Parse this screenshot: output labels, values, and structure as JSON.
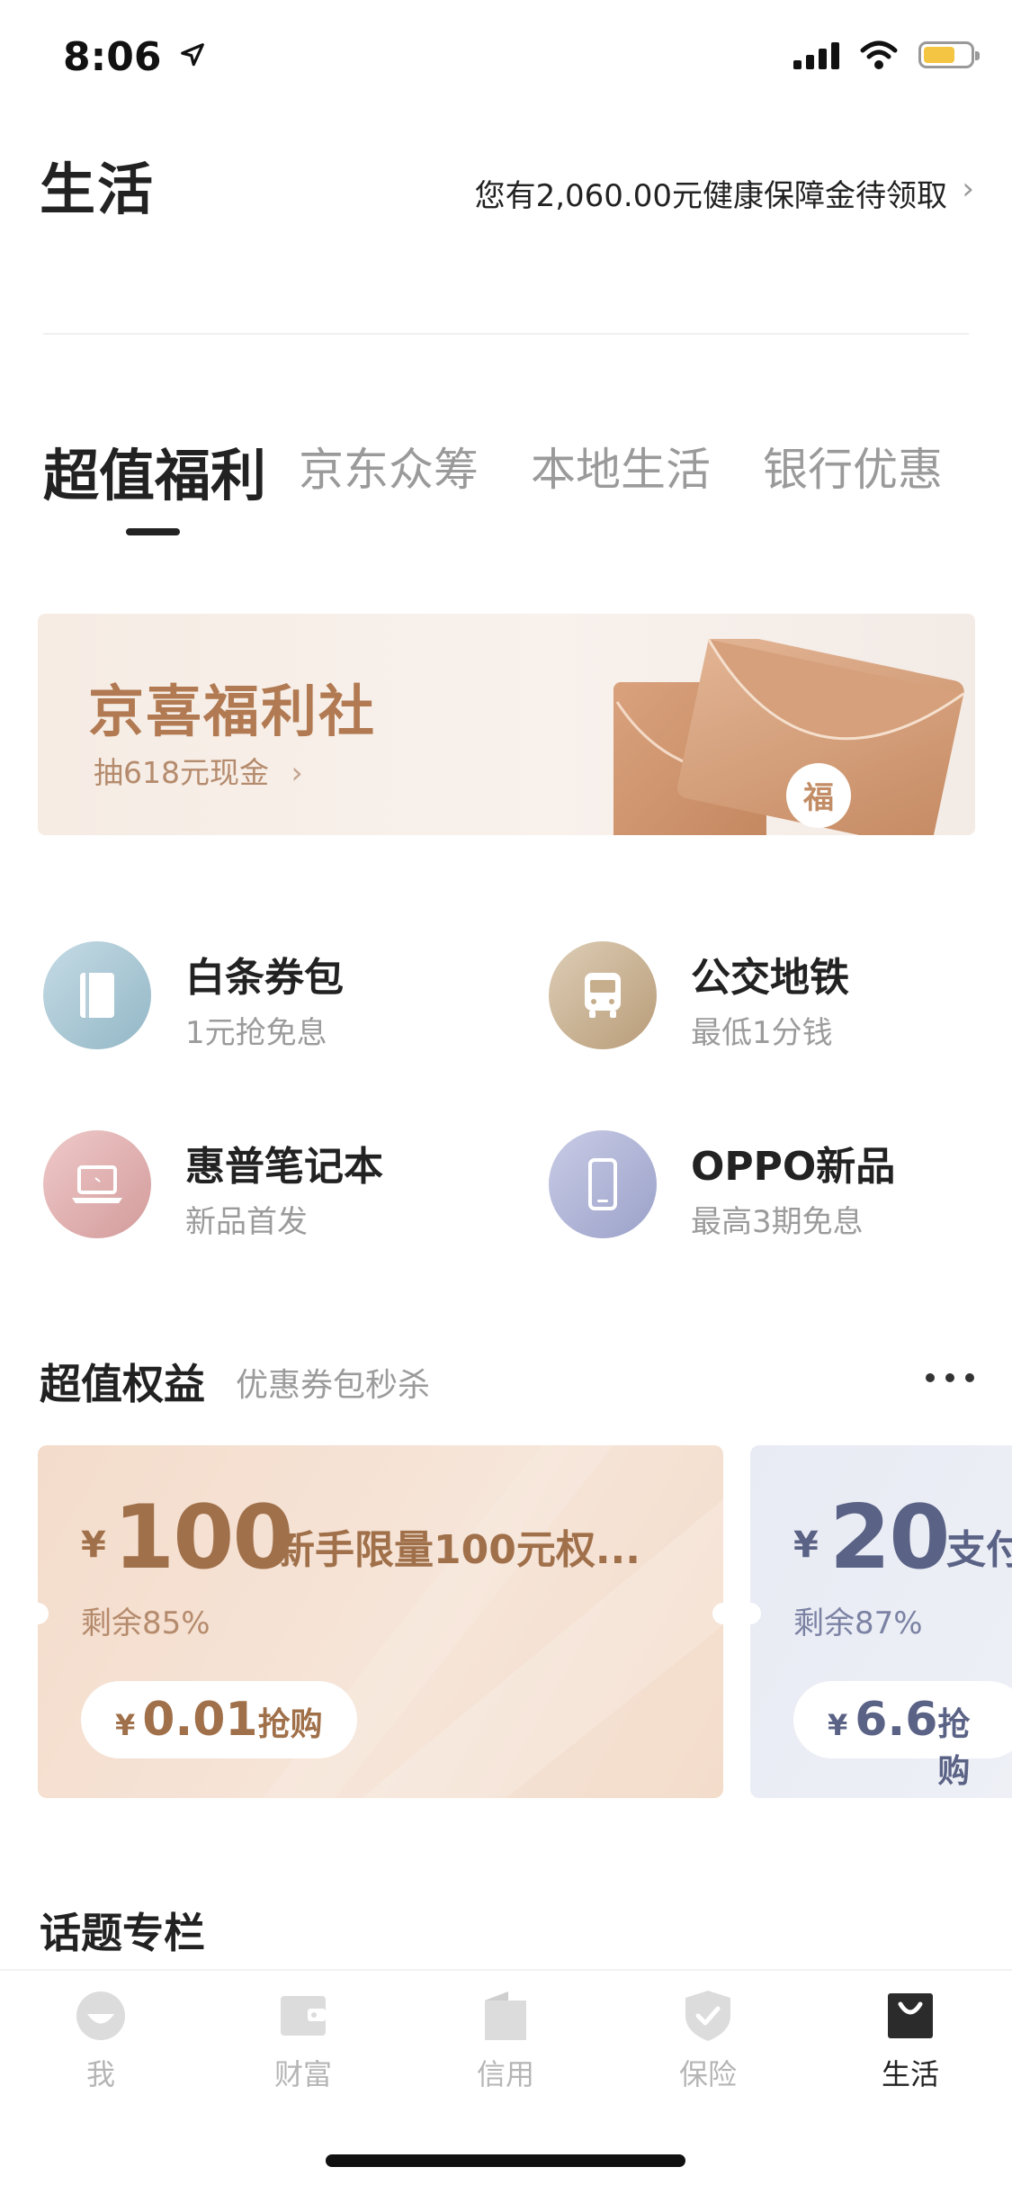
{
  "status_bar": {
    "time": "8:06",
    "icons": [
      "location-arrow-icon",
      "signal-icon",
      "wifi-icon",
      "battery-icon"
    ],
    "battery_color": "#f4c542"
  },
  "header": {
    "title": "生活",
    "promo_text": "您有2,060.00元健康保障金待领取",
    "promo_chevron": "›"
  },
  "tabs": [
    {
      "label": "超值福利",
      "active": true
    },
    {
      "label": "京东众筹",
      "active": false
    },
    {
      "label": "本地生活",
      "active": false
    },
    {
      "label": "银行优惠",
      "active": false
    }
  ],
  "banner": {
    "title": "京喜福利社",
    "subtitle": "抽618元现金",
    "chevron": "›",
    "seal_char": "福",
    "accent": "#b17a52"
  },
  "quick_grid": [
    {
      "title": "白条券包",
      "sub": "1元抢免息",
      "icon": "coupon-book-icon",
      "color": "#a9c7d6"
    },
    {
      "title": "公交地铁",
      "sub": "最低1分钱",
      "icon": "bus-icon",
      "color": "#cdb79a"
    },
    {
      "title": "惠普笔记本",
      "sub": "新品首发",
      "icon": "laptop-icon",
      "color": "#e2b3b3"
    },
    {
      "title": "OPPO新品",
      "sub": "最高3期免息",
      "icon": "phone-icon",
      "color": "#b1b6d6"
    }
  ],
  "benefits": {
    "title": "超值权益",
    "subtitle": "优惠券包秒杀",
    "cards": [
      {
        "yen": "¥",
        "amount": "100",
        "name": "新手限量100元权...",
        "remain": "剩余85%",
        "price_yen": "¥",
        "price": "0.01",
        "action": "抢购",
        "color": "#a0704a"
      },
      {
        "yen": "¥",
        "amount": "20",
        "name": "支付",
        "remain": "剩余87%",
        "price_yen": "¥",
        "price": "6.6",
        "action": "抢购",
        "color": "#5a6285"
      }
    ]
  },
  "topics": {
    "title": "话题专栏"
  },
  "tabbar": [
    {
      "label": "我",
      "icon": "profile-icon",
      "active": false
    },
    {
      "label": "财富",
      "icon": "wallet-icon",
      "active": false
    },
    {
      "label": "信用",
      "icon": "document-icon",
      "active": false
    },
    {
      "label": "保险",
      "icon": "shield-icon",
      "active": false
    },
    {
      "label": "生活",
      "icon": "shopping-bag-icon",
      "active": true
    }
  ]
}
